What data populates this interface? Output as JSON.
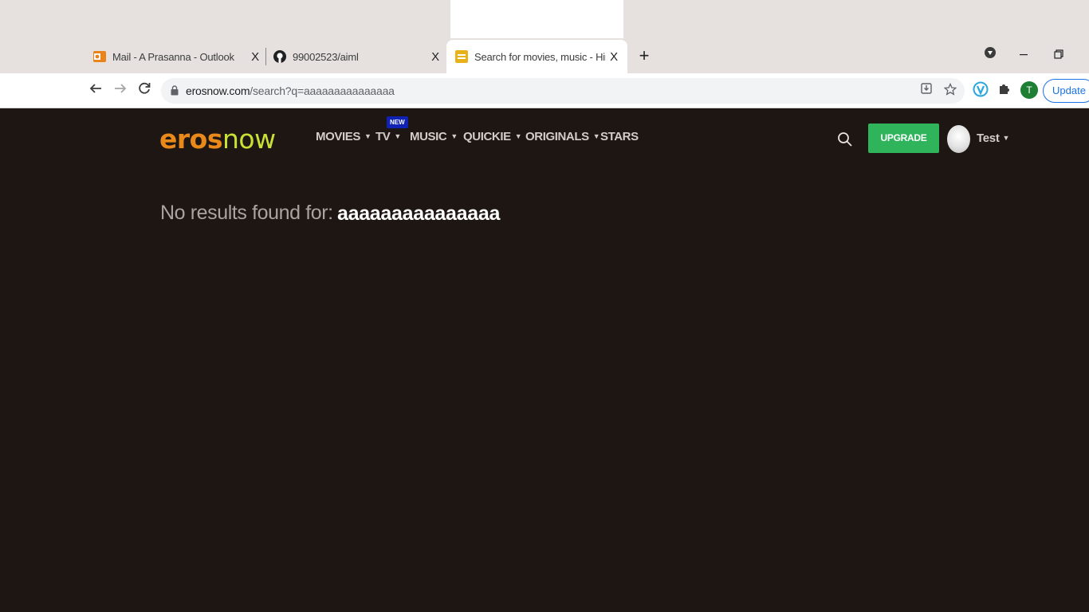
{
  "browser": {
    "tabs": [
      {
        "title": "Mail - A Prasanna - Outlook",
        "icon": "outlook-icon",
        "close": "X"
      },
      {
        "title": "99002523/aiml",
        "icon": "github-icon",
        "close": "X"
      },
      {
        "title": "Search for movies, music - Hindi",
        "icon": "erosnow-favicon",
        "close": "X",
        "active": true
      }
    ],
    "new_tab": "+",
    "url_host": "erosnow.com",
    "url_path": "/search?q=aaaaaaaaaaaaaaa",
    "profile_initial": "T",
    "update_label": "Update"
  },
  "site": {
    "logo_part1": "eros",
    "logo_part2": "now",
    "nav": [
      {
        "label": "MOVIES",
        "has_dropdown": true
      },
      {
        "label": "TV",
        "has_dropdown": true,
        "badge": "NEW"
      },
      {
        "label": "MUSIC",
        "has_dropdown": true
      },
      {
        "label": "QUICKIE",
        "has_dropdown": true
      },
      {
        "label": "ORIGINALS",
        "has_dropdown": true
      },
      {
        "label": "STARS",
        "has_dropdown": false
      }
    ],
    "upgrade_label": "UPGRADE",
    "user_name": "Test",
    "colors": {
      "background": "#1e1613",
      "upgrade": "#2fb45b",
      "logo_eros": "#e8891a",
      "logo_now": "#c9e034"
    }
  },
  "search": {
    "no_results_label": "No results found for:",
    "query": "aaaaaaaaaaaaaaa"
  }
}
